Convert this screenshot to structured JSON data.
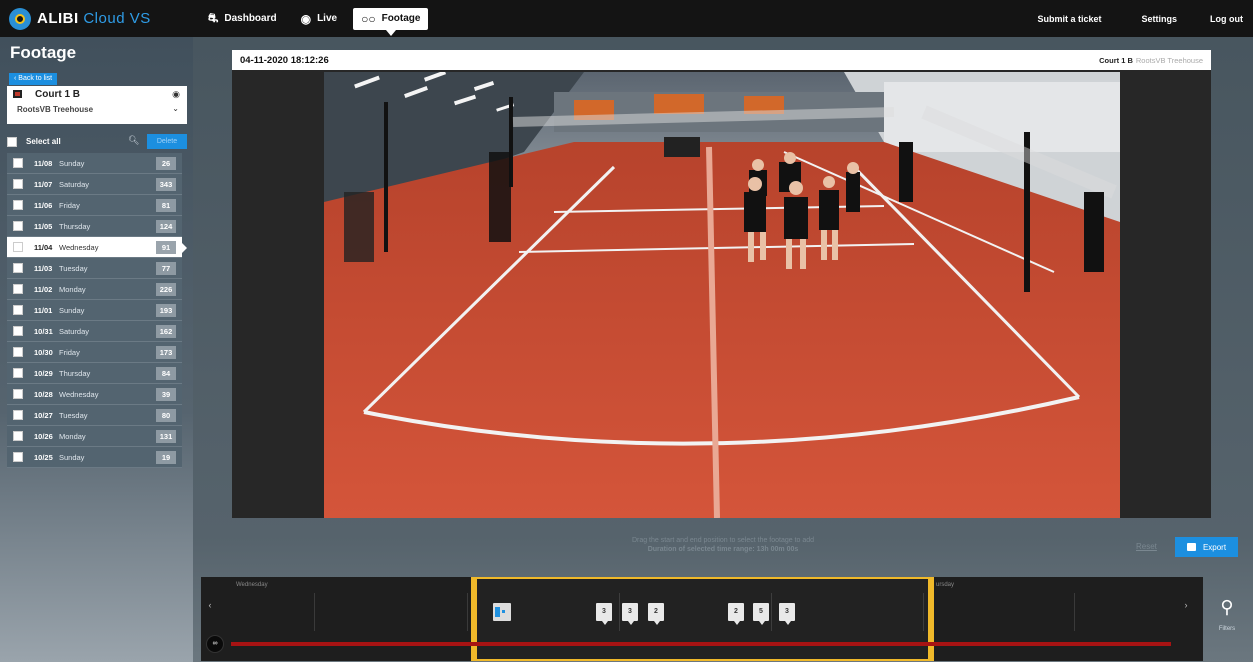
{
  "app": {
    "brand": "ALIBI",
    "product": "Cloud VS"
  },
  "nav": [
    {
      "label": "Dashboard",
      "icon": "car-icon",
      "active": false
    },
    {
      "label": "Live",
      "icon": "eye-icon",
      "active": false
    },
    {
      "label": "Footage",
      "icon": "glasses-icon",
      "active": true
    }
  ],
  "topright": {
    "ticket": "Submit a ticket",
    "settings": "Settings",
    "logout": "Log out"
  },
  "sidebar": {
    "title": "Footage",
    "back_label": "‹ Back to list",
    "camera": {
      "name": "Court 1 B",
      "site": "RootsVB Treehouse"
    },
    "select_all": "Select all",
    "delete_label": "Delete",
    "days": [
      {
        "date": "11/08",
        "day": "Sunday",
        "count": "26",
        "active": false
      },
      {
        "date": "11/07",
        "day": "Saturday",
        "count": "343",
        "active": false
      },
      {
        "date": "11/06",
        "day": "Friday",
        "count": "81",
        "active": false
      },
      {
        "date": "11/05",
        "day": "Thursday",
        "count": "124",
        "active": false
      },
      {
        "date": "11/04",
        "day": "Wednesday",
        "count": "91",
        "active": true
      },
      {
        "date": "11/03",
        "day": "Tuesday",
        "count": "77",
        "active": false
      },
      {
        "date": "11/02",
        "day": "Monday",
        "count": "226",
        "active": false
      },
      {
        "date": "11/01",
        "day": "Sunday",
        "count": "193",
        "active": false
      },
      {
        "date": "10/31",
        "day": "Saturday",
        "count": "162",
        "active": false
      },
      {
        "date": "10/30",
        "day": "Friday",
        "count": "173",
        "active": false
      },
      {
        "date": "10/29",
        "day": "Thursday",
        "count": "84",
        "active": false
      },
      {
        "date": "10/28",
        "day": "Wednesday",
        "count": "39",
        "active": false
      },
      {
        "date": "10/27",
        "day": "Tuesday",
        "count": "80",
        "active": false
      },
      {
        "date": "10/26",
        "day": "Monday",
        "count": "131",
        "active": false
      },
      {
        "date": "10/25",
        "day": "Sunday",
        "count": "19",
        "active": false
      }
    ]
  },
  "video": {
    "timestamp": "04-11-2020 18:12:26",
    "camera": "Court 1 B",
    "site": "RootsVB Treehouse"
  },
  "controls": {
    "drag_hint": "Drag the start and end position to select the footage to add",
    "duration_hint": "Duration of selected time range: 13h 00m 00s",
    "reset": "Reset",
    "export": "Export"
  },
  "timeline": {
    "day_left": "Wednesday",
    "day_right": "ursday",
    "markers": [
      "3",
      "3",
      "2",
      "2",
      "5",
      "3"
    ],
    "prev_icon": "chevron-left-icon",
    "next_icon": "chevron-right-icon"
  },
  "filters": {
    "label": "Filters",
    "icon": "search-icon"
  },
  "colors": {
    "accent": "#1c8fe0",
    "selection": "#f0b92a",
    "track": "#a71313",
    "court": "#c84d33"
  }
}
